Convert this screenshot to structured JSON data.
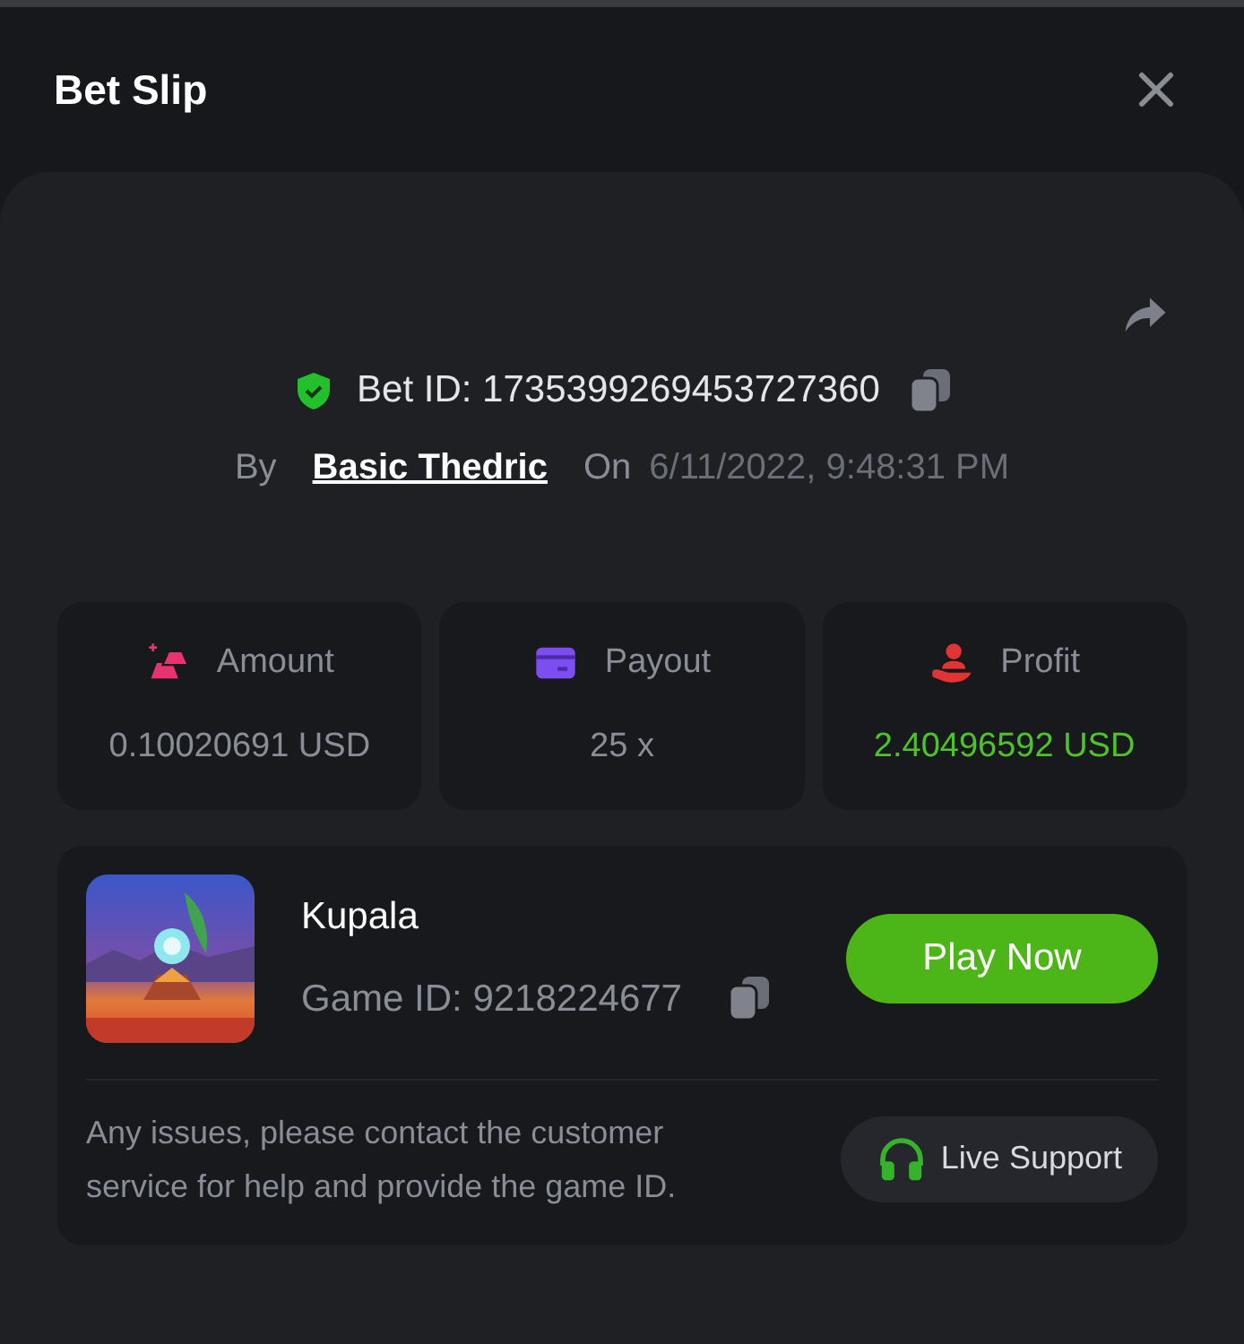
{
  "header": {
    "title": "Bet Slip"
  },
  "bet": {
    "id_label": "Bet ID: 1735399269453727360",
    "by_label": "By",
    "user": "Basic Thedric",
    "on_label": "On",
    "datetime": "6/11/2022, 9:48:31 PM"
  },
  "stats": [
    {
      "kind": "amount",
      "label": "Amount",
      "value": "0.10020691 USD",
      "highlight": false
    },
    {
      "kind": "payout",
      "label": "Payout",
      "value": "25 x",
      "highlight": false
    },
    {
      "kind": "profit",
      "label": "Profit",
      "value": "2.40496592 USD",
      "highlight": true
    }
  ],
  "game": {
    "name": "Kupala",
    "game_id": "Game ID: 9218224677",
    "play_button": "Play Now"
  },
  "support": {
    "note": "Any issues, please contact the customer service for help and provide the game ID.",
    "button": "Live Support"
  }
}
